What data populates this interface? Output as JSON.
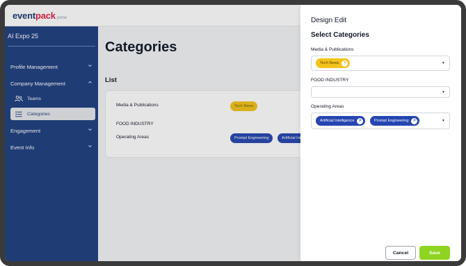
{
  "brand": {
    "part1": "event",
    "part2": "pack",
    "suffix": "portal"
  },
  "sidebar": {
    "org": "AI Expo 25",
    "items": [
      {
        "label": "Profile Management",
        "chevron": "chevron-down-icon"
      },
      {
        "label": "Company Management",
        "chevron": "chevron-up-icon"
      },
      {
        "label": "Engagement",
        "chevron": "chevron-down-icon"
      },
      {
        "label": "Event Info",
        "chevron": "chevron-down-icon"
      }
    ],
    "subitems": [
      {
        "label": "Teams",
        "icon": "users-icon"
      },
      {
        "label": "Categories",
        "icon": "list-icon",
        "active": true
      }
    ]
  },
  "main": {
    "title": "Categories",
    "list_title": "List",
    "rows": [
      {
        "label": "Media & Publications",
        "chips": [
          "Tech News"
        ]
      },
      {
        "label": "FOOD INDUSTRY",
        "chips": []
      },
      {
        "label": "Operating Areas",
        "chips": [
          "Prompt Engineering",
          "Artificial Intelligence"
        ]
      }
    ]
  },
  "drawer": {
    "title": "Design Edit",
    "subtitle": "Select Categories",
    "fields": [
      {
        "label": "Media & Publications",
        "selected": [
          "Tech News"
        ]
      },
      {
        "label": "FOOD INDUSTRY",
        "selected": []
      },
      {
        "label": "Operating Areas",
        "selected": [
          "Artificial Intelligence",
          "Prompt Engineering"
        ]
      }
    ],
    "cancel_label": "Cancel",
    "save_label": "Save"
  },
  "colors": {
    "sidebar": "#1e3f80",
    "chip_yellow": "#f2c31b",
    "chip_blue": "#2546b0",
    "save_button": "#8fd422"
  }
}
